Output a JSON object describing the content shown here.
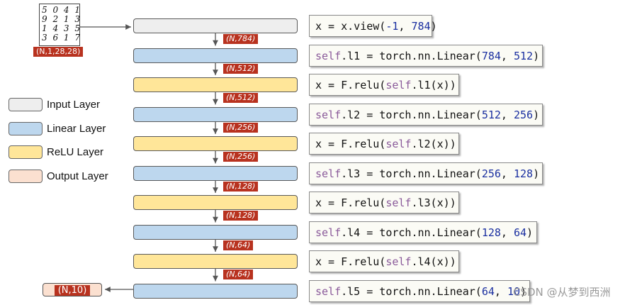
{
  "colors": {
    "input": "#eeeeee",
    "linear": "#bdd7ee",
    "relu": "#ffe699",
    "output": "#fbe0d0",
    "tag": "#b8321f",
    "keyword": "#8a5a9a",
    "number": "#1a2fa0"
  },
  "mnist_image": {
    "digit_rows": [
      "5 0 4 1",
      "9 2 1 3",
      "1 4 3 5",
      "3 6 1 7"
    ],
    "shape_tag": "(N,1,28,28)"
  },
  "legend": [
    {
      "label": "Input Layer",
      "kind": "input"
    },
    {
      "label": "Linear Layer",
      "kind": "linear"
    },
    {
      "label": "ReLU Layer",
      "kind": "relu"
    },
    {
      "label": "Output Layer",
      "kind": "output"
    }
  ],
  "layers": [
    {
      "kind": "input"
    },
    {
      "kind": "linear"
    },
    {
      "kind": "relu"
    },
    {
      "kind": "linear"
    },
    {
      "kind": "relu"
    },
    {
      "kind": "linear"
    },
    {
      "kind": "relu"
    },
    {
      "kind": "linear"
    },
    {
      "kind": "relu"
    },
    {
      "kind": "linear"
    }
  ],
  "shape_tags": [
    "(N,784)",
    "(N,512)",
    "(N,512)",
    "(N,256)",
    "(N,256)",
    "(N,128)",
    "(N,128)",
    "(N,64)",
    "(N,64)"
  ],
  "output_tag": "(N,10)",
  "code_lines": [
    {
      "text": "x = x.view(-1, 784)"
    },
    {
      "text": "self.l1 = torch.nn.Linear(784, 512)"
    },
    {
      "text": "x = F.relu(self.l1(x))"
    },
    {
      "text": "self.l2 = torch.nn.Linear(512, 256)"
    },
    {
      "text": "x = F.relu(self.l2(x))"
    },
    {
      "text": "self.l3 = torch.nn.Linear(256, 128)"
    },
    {
      "text": "x = F.relu(self.l3(x))"
    },
    {
      "text": "self.l4 = torch.nn.Linear(128, 64)"
    },
    {
      "text": "x = F.relu(self.l4(x))"
    },
    {
      "text": "self.l5 = torch.nn.Linear(64, 10)"
    }
  ],
  "watermark": "CSDN @从梦到西洲"
}
